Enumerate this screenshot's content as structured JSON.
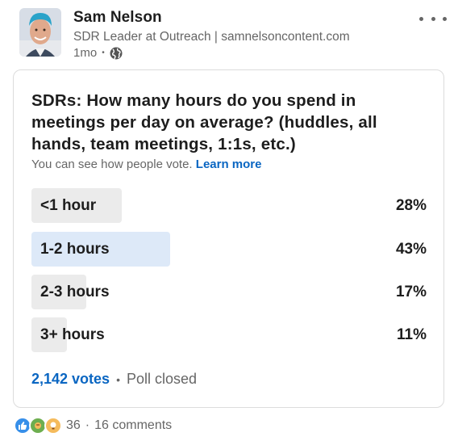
{
  "post": {
    "author_name": "Sam Nelson",
    "author_headline": "SDR Leader at Outreach | samnelsoncontent.com",
    "timestamp": "1mo",
    "separator": "•",
    "visibility_icon": "globe-icon",
    "menu_icon": "more-horizontal-icon"
  },
  "poll": {
    "question": "SDRs: How many hours do you spend in meetings per day on average? (huddles, all hands, team meetings, 1:1s, etc.)",
    "visibility_text": "You can see how people vote.",
    "learn_more": "Learn more",
    "options": [
      {
        "label": "<1 hour",
        "percent": "28%",
        "fraction": 0.28,
        "selected": false
      },
      {
        "label": "1-2 hours",
        "percent": "43%",
        "fraction": 0.43,
        "selected": true
      },
      {
        "label": "2-3 hours",
        "percent": "17%",
        "fraction": 0.17,
        "selected": false
      },
      {
        "label": "3+ hours",
        "percent": "11%",
        "fraction": 0.11,
        "selected": false
      }
    ],
    "votes": "2,142 votes",
    "footer_separator": "•",
    "status": "Poll closed"
  },
  "social": {
    "reaction_icons": [
      "like-icon",
      "celebrate-icon",
      "insightful-icon"
    ],
    "reaction_count": "36",
    "separator": "·",
    "comments": "16 comments"
  },
  "colors": {
    "brand_blue": "#0a66c2",
    "selected_bar": "#dde9f8",
    "unselected_bar": "#ebebeb"
  }
}
